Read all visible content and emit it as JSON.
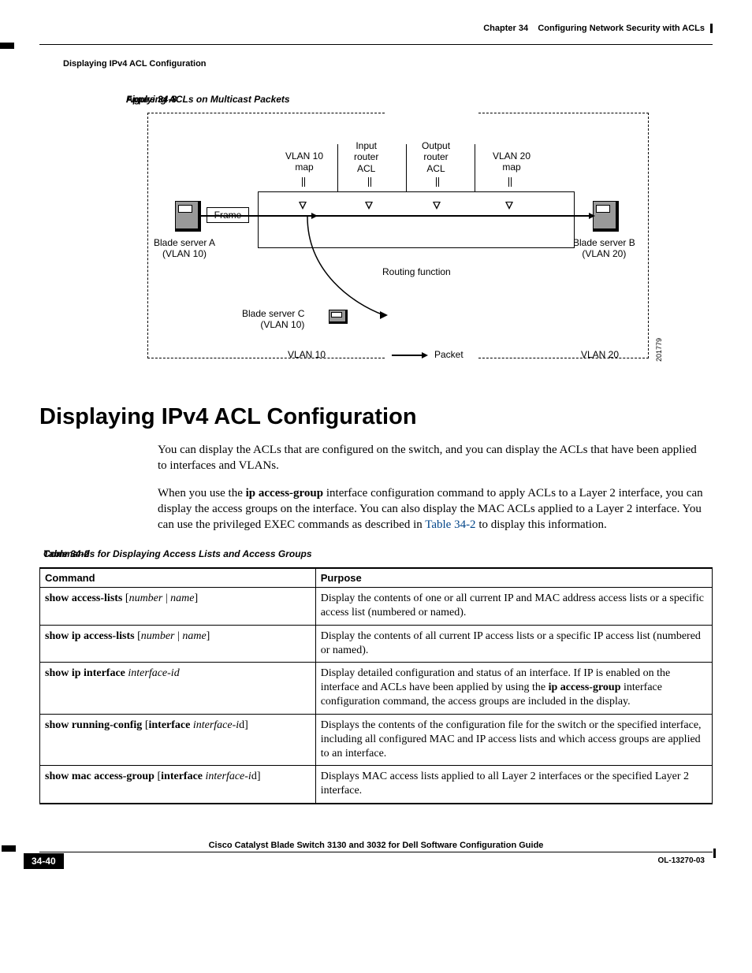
{
  "header": {
    "chapter_prefix": "Chapter 34",
    "chapter_title": "Configuring Network Security with ACLs",
    "section_name": "Displaying IPv4 ACL Configuration"
  },
  "figure": {
    "label": "Figure 34-8",
    "title": "Applying ACLs on Multicast Packets",
    "vlan10_map": "VLAN 10\nmap",
    "input_acl": "Input\nrouter\nACL",
    "output_acl": "Output\nrouter\nACL",
    "vlan20_map": "VLAN 20\nmap",
    "frame": "Frame",
    "blade_a": "Blade server A\n(VLAN 10)",
    "blade_b": "Blade server B\n(VLAN 20)",
    "blade_c": "Blade server C\n(VLAN 10)",
    "routing": "Routing function",
    "vlan10": "VLAN 10",
    "vlan20": "VLAN 20",
    "packet": "Packet",
    "image_id": "201779"
  },
  "section": {
    "title": "Displaying IPv4 ACL Configuration",
    "para1": "You can display the ACLs that are configured on the switch, and you can display the ACLs that have been applied to interfaces and VLANs.",
    "para2_a": "When you use the ",
    "para2_b": "ip access-group",
    "para2_c": " interface configuration command to apply ACLs to a Layer 2 interface, you can display the access groups on the interface. You can also display the MAC ACLs applied to a Layer 2 interface. You can use the privileged EXEC commands as described in ",
    "para2_d": "Table 34-2",
    "para2_e": " to display this information."
  },
  "table": {
    "label": "Table 34-2",
    "title": "Commands for Displaying Access Lists and Access Groups",
    "headers": {
      "command": "Command",
      "purpose": "Purpose"
    },
    "rows": [
      {
        "cmd_bold1": "show access-lists ",
        "cmd_plain1": "[",
        "cmd_ital1": "number",
        "cmd_plain2": " | ",
        "cmd_ital2": "name",
        "cmd_plain3": "]",
        "purpose": "Display the contents of one or all current IP and MAC address access lists or a specific access list (numbered or named)."
      },
      {
        "cmd_bold1": "show ip access-lists ",
        "cmd_plain1": "[",
        "cmd_ital1": "number",
        "cmd_plain2": " | ",
        "cmd_ital2": "name",
        "cmd_plain3": "]",
        "purpose": "Display the contents of all current IP access lists or a specific IP access list (numbered or named)."
      },
      {
        "cmd_bold1": "show ip interface ",
        "cmd_ital1": "interface-id",
        "purpose_a": "Display detailed configuration and status of an interface. If IP is enabled on the interface and ACLs have been applied by using the ",
        "purpose_bold": "ip access-group",
        "purpose_b": " interface configuration command, the access groups are included in the display."
      },
      {
        "cmd_bold1": "show running-config ",
        "cmd_plain1": "[",
        "cmd_bold2": "interface ",
        "cmd_ital1": "interface-i",
        "cmd_plain2": "d]",
        "purpose": "Displays the contents of the configuration file for the switch or the specified interface, including all configured MAC and IP access lists and which access groups are applied to an interface."
      },
      {
        "cmd_bold1": "show mac access-group ",
        "cmd_plain1": "[",
        "cmd_bold2": "interface ",
        "cmd_ital1": "interface-i",
        "cmd_plain2": "d]",
        "purpose": "Displays MAC access lists applied to all Layer 2 interfaces or the specified Layer 2 interface."
      }
    ]
  },
  "footer": {
    "book_title": "Cisco Catalyst Blade Switch 3130 and 3032 for Dell Software Configuration Guide",
    "page_number": "34-40",
    "doc_id": "OL-13270-03"
  }
}
